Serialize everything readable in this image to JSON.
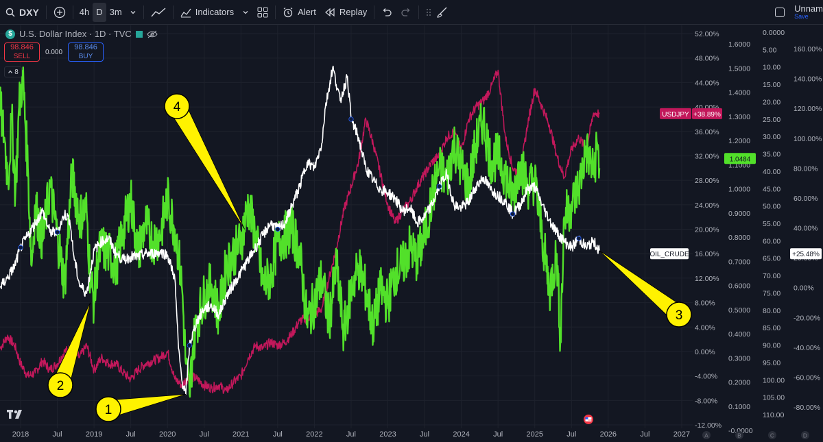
{
  "toolbar": {
    "symbol": "DXY",
    "intervals": [
      "4h",
      "D",
      "3m"
    ],
    "active_interval": "D",
    "indicators_label": "Indicators",
    "alert_label": "Alert",
    "replay_label": "Replay",
    "layout_name": "Unnam",
    "save_label": "Save"
  },
  "legend": {
    "title": "U.S. Dollar Index · 1D · TVC",
    "sell_price": "98.846",
    "sell_label": "SELL",
    "buy_price": "98.846",
    "buy_label": "BUY",
    "spread": "0.000",
    "collapsed_count": "8"
  },
  "colors": {
    "background": "#131722",
    "dxy": "#ffffff",
    "oil": "#52e02a",
    "usdjpy": "#c2185b",
    "callout": "#fff200"
  },
  "chart_data": {
    "type": "line",
    "x_ticks": [
      "2018",
      "Jul",
      "2019",
      "Jul",
      "2020",
      "Jul",
      "2021",
      "Jul",
      "2022",
      "Jul",
      "2023",
      "Jul",
      "2024",
      "Jul",
      "2025",
      "Jul",
      "2026",
      "Jul",
      "2027"
    ],
    "y_axes": [
      {
        "scale": "percent",
        "ticks": [
          "52.00%",
          "48.00%",
          "44.00%",
          "40.00%",
          "36.00%",
          "32.00%",
          "28.00%",
          "24.00%",
          "20.00%",
          "16.00%",
          "12.00%",
          "8.00%",
          "4.00%",
          "0.00%",
          "-4.00%",
          "-8.00%",
          "-12.00%"
        ],
        "range": [
          -12,
          52
        ]
      },
      {
        "scale": "price",
        "ticks": [
          "1.6000",
          "1.5000",
          "1.4000",
          "1.3000",
          "1.2000",
          "1.1000",
          "1.0000",
          "0.9000",
          "0.8000",
          "0.7000",
          "0.6000",
          "0.5000",
          "0.4000",
          "0.3000",
          "0.2000",
          "0.1000",
          "-0.0000"
        ]
      },
      {
        "scale": "inverted",
        "ticks": [
          "0.0000",
          "5.00",
          "10.00",
          "15.00",
          "20.00",
          "25.00",
          "30.00",
          "35.00",
          "40.00",
          "45.00",
          "50.00",
          "55.00",
          "60.00",
          "65.00",
          "70.00",
          "75.00",
          "80.00",
          "85.00",
          "90.00",
          "95.00",
          "100.00",
          "105.00",
          "110.00"
        ]
      },
      {
        "scale": "percent",
        "ticks": [
          "160.00%",
          "140.00%",
          "120.00%",
          "100.00%",
          "80.00%",
          "60.00%",
          "40.00%",
          "20.00%",
          "0.00%",
          "-20.00%",
          "-40.00%",
          "-60.00%",
          "-80.00%"
        ]
      }
    ],
    "scale_buttons": [
      "A",
      "B",
      "C",
      "D"
    ],
    "series": [
      {
        "name": "DXY",
        "color": "#ffffff",
        "x": [
          2017.72,
          2017.82,
          2017.92,
          2018.0,
          2018.1,
          2018.2,
          2018.3,
          2018.4,
          2018.5,
          2018.6,
          2018.67,
          2018.72,
          2018.8,
          2018.9,
          2019.0,
          2019.1,
          2019.2,
          2019.3,
          2019.4,
          2019.5,
          2019.6,
          2019.7,
          2019.8,
          2019.9,
          2020.0,
          2020.1,
          2020.15,
          2020.2,
          2020.25,
          2020.3,
          2020.4,
          2020.5,
          2020.6,
          2020.7,
          2020.8,
          2020.9,
          2021.0,
          2021.1,
          2021.2,
          2021.3,
          2021.4,
          2021.5,
          2021.6,
          2021.7,
          2021.8,
          2021.9,
          2022.0,
          2022.1,
          2022.15,
          2022.25,
          2022.35,
          2022.45,
          2022.5,
          2022.6,
          2022.7,
          2022.8,
          2022.9,
          2023.0,
          2023.1,
          2023.2,
          2023.3,
          2023.4,
          2023.5,
          2023.6,
          2023.7,
          2023.8,
          2023.9,
          2024.0,
          2024.1,
          2024.2,
          2024.3,
          2024.4,
          2024.5,
          2024.6,
          2024.7,
          2024.8,
          2024.9,
          2025.0,
          2025.1,
          2025.2,
          2025.3,
          2025.4,
          2025.5,
          2025.6,
          2025.7,
          2025.8,
          2025.88
        ],
        "y": [
          10.5,
          12.0,
          14.0,
          17.0,
          19.0,
          21.0,
          23.0,
          19.5,
          19.5,
          22.5,
          21.5,
          16.0,
          11.0,
          9.5,
          16.5,
          18.0,
          18.5,
          16.0,
          15.0,
          15.5,
          15.5,
          16.0,
          16.0,
          16.3,
          15.8,
          12.0,
          0.5,
          -5.0,
          -7.0,
          1.0,
          5.0,
          7.0,
          7.5,
          6.0,
          9.0,
          11.0,
          13.0,
          15.0,
          17.0,
          19.0,
          21.0,
          20.0,
          21.0,
          24.0,
          27.0,
          31.0,
          30.0,
          34.0,
          40.0,
          46.5,
          41.0,
          45.0,
          38.0,
          35.0,
          30.0,
          28.0,
          26.5,
          26.0,
          25.0,
          23.0,
          23.5,
          21.0,
          22.0,
          24.0,
          27.0,
          29.0,
          24.0,
          23.5,
          24.5,
          27.0,
          28.5,
          26.5,
          25.5,
          24.5,
          22.5,
          24.0,
          26.5,
          27.0,
          24.0,
          21.5,
          19.5,
          18.0,
          17.0,
          18.5,
          17.0,
          18.0,
          16.5
        ]
      },
      {
        "name": "OIL_CRUDE",
        "color": "#52e02a",
        "x": [
          2017.72,
          2017.78,
          2017.83,
          2017.88,
          2017.93,
          2017.98,
          2018.03,
          2018.1,
          2018.15,
          2018.2,
          2018.3,
          2018.4,
          2018.5,
          2018.6,
          2018.7,
          2018.8,
          2018.9,
          2018.95,
          2019.0,
          2019.05,
          2019.1,
          2019.2,
          2019.3,
          2019.4,
          2019.5,
          2019.6,
          2019.7,
          2019.8,
          2019.9,
          2020.0,
          2020.1,
          2020.15,
          2020.2,
          2020.25,
          2020.3,
          2020.35,
          2020.4,
          2020.5,
          2020.6,
          2020.7,
          2020.8,
          2020.9,
          2021.0,
          2021.1,
          2021.2,
          2021.3,
          2021.4,
          2021.5,
          2021.6,
          2021.7,
          2021.8,
          2021.9,
          2022.0,
          2022.1,
          2022.2,
          2022.3,
          2022.4,
          2022.5,
          2022.6,
          2022.7,
          2022.8,
          2022.9,
          2023.0,
          2023.1,
          2023.2,
          2023.3,
          2023.4,
          2023.5,
          2023.6,
          2023.7,
          2023.8,
          2023.9,
          2024.0,
          2024.1,
          2024.2,
          2024.3,
          2024.4,
          2024.5,
          2024.6,
          2024.7,
          2024.8,
          2024.9,
          2025.0,
          2025.1,
          2025.2,
          2025.3,
          2025.35,
          2025.4,
          2025.5,
          2025.6,
          2025.7,
          2025.8,
          2025.85,
          2025.88
        ],
        "y": [
          40.0,
          35.0,
          28.0,
          38.0,
          26.0,
          40.0,
          45.0,
          30.0,
          14.0,
          24.0,
          18.0,
          27.0,
          19.0,
          11.0,
          29.0,
          22.0,
          23.0,
          12.0,
          8.0,
          15.0,
          17.0,
          16.0,
          14.0,
          20.0,
          25.0,
          16.0,
          21.0,
          18.0,
          19.0,
          25.0,
          20.0,
          16.0,
          10.0,
          -2.0,
          -7.0,
          1.0,
          5.0,
          9.0,
          11.0,
          6.0,
          14.0,
          16.0,
          18.0,
          24.0,
          19.0,
          11.0,
          12.0,
          18.0,
          19.0,
          20.0,
          16.0,
          5.0,
          8.0,
          12.0,
          5.0,
          14.0,
          3.0,
          10.0,
          14.0,
          10.0,
          4.0,
          10.0,
          8.0,
          13.0,
          14.0,
          17.0,
          15.0,
          19.0,
          25.0,
          30.0,
          28.0,
          34.0,
          30.0,
          27.0,
          34.0,
          38.0,
          31.0,
          32.0,
          29.0,
          25.0,
          31.0,
          27.0,
          28.0,
          19.0,
          10.0,
          16.0,
          2.0,
          22.0,
          24.0,
          27.0,
          33.0,
          29.0,
          34.0,
          30.0
        ]
      },
      {
        "name": "USDJPY",
        "color": "#c2185b",
        "x": [
          2017.72,
          2017.82,
          2017.92,
          2018.0,
          2018.1,
          2018.2,
          2018.3,
          2018.4,
          2018.5,
          2018.6,
          2018.7,
          2018.8,
          2018.9,
          2019.0,
          2019.1,
          2019.2,
          2019.3,
          2019.4,
          2019.5,
          2019.6,
          2019.7,
          2019.8,
          2019.9,
          2020.0,
          2020.1,
          2020.2,
          2020.3,
          2020.4,
          2020.5,
          2020.6,
          2020.7,
          2020.8,
          2020.9,
          2021.0,
          2021.1,
          2021.2,
          2021.3,
          2021.4,
          2021.5,
          2021.6,
          2021.7,
          2021.8,
          2021.9,
          2022.0,
          2022.1,
          2022.2,
          2022.3,
          2022.4,
          2022.5,
          2022.6,
          2022.7,
          2022.8,
          2022.9,
          2023.0,
          2023.1,
          2023.2,
          2023.3,
          2023.4,
          2023.5,
          2023.6,
          2023.7,
          2023.8,
          2023.9,
          2024.0,
          2024.1,
          2024.2,
          2024.3,
          2024.4,
          2024.5,
          2024.6,
          2024.7,
          2024.8,
          2024.9,
          2025.0,
          2025.1,
          2025.2,
          2025.3,
          2025.4,
          2025.5,
          2025.6,
          2025.7,
          2025.8,
          2025.88
        ],
        "y": [
          0.5,
          2.5,
          1.0,
          -2.0,
          -4.0,
          -3.5,
          -1.5,
          -3.0,
          -2.0,
          0.0,
          0.5,
          -1.0,
          1.0,
          -3.0,
          -1.0,
          -2.0,
          -2.0,
          -3.5,
          -4.5,
          -3.0,
          -2.0,
          -1.5,
          -1.0,
          0.0,
          -4.5,
          -5.5,
          -4.0,
          -4.5,
          -5.5,
          -6.0,
          -5.5,
          -6.5,
          -5.0,
          -4.0,
          -1.0,
          1.0,
          0.5,
          1.5,
          1.0,
          1.5,
          3.0,
          5.0,
          5.5,
          6.0,
          7.0,
          12.0,
          17.0,
          23.0,
          27.0,
          31.0,
          38.0,
          34.0,
          29.0,
          24.0,
          21.0,
          23.0,
          24.5,
          27.0,
          29.0,
          31.0,
          32.0,
          35.0,
          36.0,
          33.0,
          38.0,
          40.0,
          41.0,
          43.0,
          46.0,
          35.0,
          30.0,
          29.0,
          37.0,
          43.0,
          40.0,
          37.0,
          32.0,
          28.5,
          33.0,
          35.0,
          33.0,
          39.0,
          38.9
        ]
      }
    ],
    "price_labels": [
      {
        "text": "USDJPY",
        "value": "+38.89%",
        "color": "#c2185b"
      },
      {
        "text": "",
        "value": "1.0484",
        "color": "#52e02a"
      },
      {
        "text": "OIL_CRUDE",
        "value": "+25.48%",
        "color": "#ffffff"
      }
    ],
    "annotations": [
      {
        "label": "1",
        "at": [
          2020.25,
          -7.0
        ]
      },
      {
        "label": "2",
        "at": [
          2018.95,
          8.0
        ]
      },
      {
        "label": "3",
        "at": [
          2025.88,
          16.5
        ]
      },
      {
        "label": "4",
        "at": [
          2021.05,
          20.0
        ]
      }
    ]
  }
}
